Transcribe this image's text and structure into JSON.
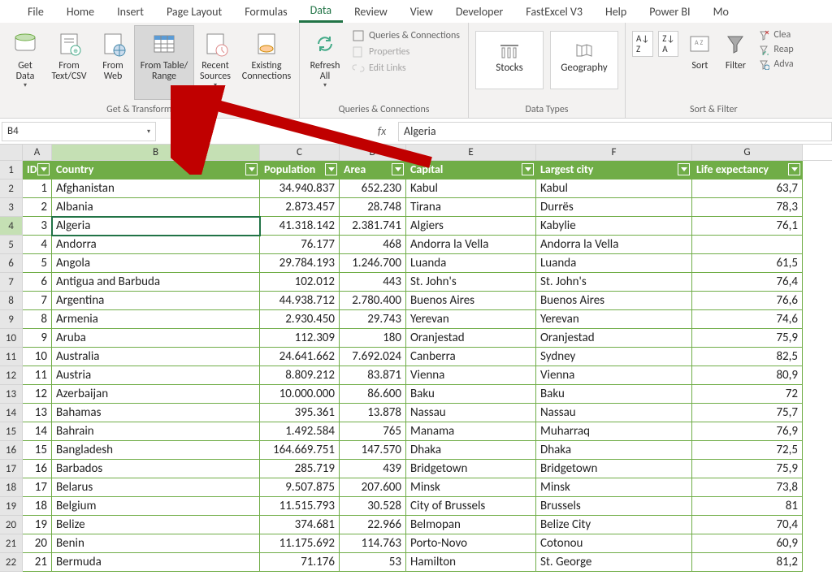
{
  "tabs": [
    "File",
    "Home",
    "Insert",
    "Page Layout",
    "Formulas",
    "Data",
    "Review",
    "View",
    "Developer",
    "FastExcel V3",
    "Help",
    "Power BI",
    "Mo"
  ],
  "active_tab": "Data",
  "ribbon": {
    "get_transform": {
      "label": "Get & Transform Data",
      "get_data": "Get\nData",
      "from_text": "From\nText/CSV",
      "from_web": "From\nWeb",
      "from_table": "From Table/\nRange",
      "recent": "Recent\nSources",
      "existing": "Existing\nConnections"
    },
    "queries": {
      "label": "Queries & Connections",
      "refresh": "Refresh\nAll",
      "qc": "Queries & Connections",
      "props": "Properties",
      "edit": "Edit Links"
    },
    "data_types": {
      "label": "Data Types",
      "stocks": "Stocks",
      "geography": "Geography"
    },
    "sort_filter": {
      "label": "Sort & Filter",
      "sort": "Sort",
      "filter": "Filter",
      "clear": "Clea",
      "reapply": "Reap",
      "advanced": "Adva"
    }
  },
  "formula_bar": {
    "name": "B4",
    "value": "Algeria"
  },
  "columns": [
    "A",
    "B",
    "C",
    "D",
    "E",
    "F",
    "G"
  ],
  "selected_col": "B",
  "selected_row": 4,
  "headers": [
    "ID",
    "Country",
    "Population",
    "Area",
    "Capital",
    "Largest city",
    "Life expectancy"
  ],
  "rows": [
    {
      "n": 1,
      "c": "Afghanistan",
      "p": "34.940.837",
      "a": "652.230",
      "cap": "Kabul",
      "lc": "Kabul",
      "le": "63,7"
    },
    {
      "n": 2,
      "c": "Albania",
      "p": "2.873.457",
      "a": "28.748",
      "cap": "Tirana",
      "lc": "Durrës",
      "le": "78,3"
    },
    {
      "n": 3,
      "c": "Algeria",
      "p": "41.318.142",
      "a": "2.381.741",
      "cap": "Algiers",
      "lc": "Kabylie",
      "le": "76,1"
    },
    {
      "n": 4,
      "c": "Andorra",
      "p": "76.177",
      "a": "468",
      "cap": "Andorra la Vella",
      "lc": "Andorra la Vella",
      "le": ""
    },
    {
      "n": 5,
      "c": "Angola",
      "p": "29.784.193",
      "a": "1.246.700",
      "cap": "Luanda",
      "lc": "Luanda",
      "le": "61,5"
    },
    {
      "n": 6,
      "c": "Antigua and Barbuda",
      "p": "102.012",
      "a": "443",
      "cap": "St. John's",
      "lc": "St. John's",
      "le": "76,4"
    },
    {
      "n": 7,
      "c": "Argentina",
      "p": "44.938.712",
      "a": "2.780.400",
      "cap": "Buenos Aires",
      "lc": "Buenos Aires",
      "le": "76,6"
    },
    {
      "n": 8,
      "c": "Armenia",
      "p": "2.930.450",
      "a": "29.743",
      "cap": "Yerevan",
      "lc": "Yerevan",
      "le": "74,6"
    },
    {
      "n": 9,
      "c": "Aruba",
      "p": "112.309",
      "a": "180",
      "cap": "Oranjestad",
      "lc": "Oranjestad",
      "le": "75,9"
    },
    {
      "n": 10,
      "c": "Australia",
      "p": "24.641.662",
      "a": "7.692.024",
      "cap": "Canberra",
      "lc": "Sydney",
      "le": "82,5"
    },
    {
      "n": 11,
      "c": "Austria",
      "p": "8.809.212",
      "a": "83.871",
      "cap": "Vienna",
      "lc": "Vienna",
      "le": "80,9"
    },
    {
      "n": 12,
      "c": "Azerbaijan",
      "p": "10.000.000",
      "a": "86.600",
      "cap": "Baku",
      "lc": "Baku",
      "le": "72"
    },
    {
      "n": 13,
      "c": "Bahamas",
      "p": "395.361",
      "a": "13.878",
      "cap": "Nassau",
      "lc": "Nassau",
      "le": "75,7"
    },
    {
      "n": 14,
      "c": "Bahrain",
      "p": "1.492.584",
      "a": "765",
      "cap": "Manama",
      "lc": "Muharraq",
      "le": "76,9"
    },
    {
      "n": 15,
      "c": "Bangladesh",
      "p": "164.669.751",
      "a": "147.570",
      "cap": "Dhaka",
      "lc": "Dhaka",
      "le": "72,5"
    },
    {
      "n": 16,
      "c": "Barbados",
      "p": "285.719",
      "a": "439",
      "cap": "Bridgetown",
      "lc": "Bridgetown",
      "le": "75,9"
    },
    {
      "n": 17,
      "c": "Belarus",
      "p": "9.507.875",
      "a": "207.600",
      "cap": "Minsk",
      "lc": "Minsk",
      "le": "73,8"
    },
    {
      "n": 18,
      "c": "Belgium",
      "p": "11.515.793",
      "a": "30.528",
      "cap": "City of Brussels",
      "lc": "Brussels",
      "le": "81"
    },
    {
      "n": 19,
      "c": "Belize",
      "p": "374.681",
      "a": "22.966",
      "cap": "Belmopan",
      "lc": "Belize City",
      "le": "70,4"
    },
    {
      "n": 20,
      "c": "Benin",
      "p": "11.175.692",
      "a": "114.763",
      "cap": "Porto-Novo",
      "lc": "Cotonou",
      "le": "60,9"
    },
    {
      "n": 21,
      "c": "Bermuda",
      "p": "71.176",
      "a": "53",
      "cap": "Hamilton",
      "lc": "St. George",
      "le": "81,2"
    }
  ]
}
